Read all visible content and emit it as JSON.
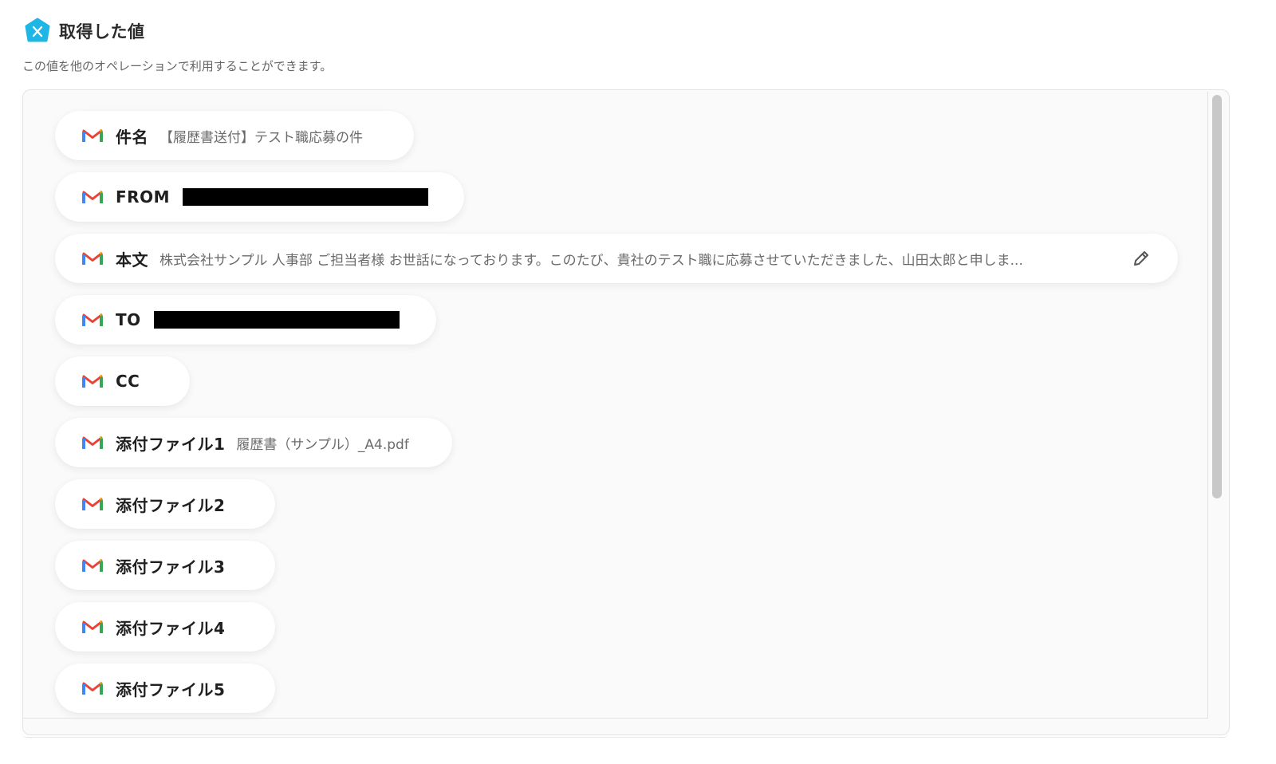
{
  "header": {
    "icon": "x-variable-hexagon-icon",
    "title": "取得した値",
    "subtitle": "この値を他のオペレーションで利用することができます。"
  },
  "colors": {
    "accent": "#1EB6E5",
    "gmail_red": "#EA4335",
    "gmail_blue": "#4285F4",
    "gmail_green": "#34A853",
    "gmail_yellow": "#FBBC04",
    "redaction": "#000000"
  },
  "fields": [
    {
      "icon": "gmail-icon",
      "label": "件名",
      "value": "【履歴書送付】テスト職応募の件"
    },
    {
      "icon": "gmail-icon",
      "label": "FROM",
      "value": "",
      "redacted": true
    },
    {
      "icon": "gmail-icon",
      "label": "本文",
      "value": "株式会社サンプル 人事部 ご担当者様 お世話になっております。このたび、貴社のテスト職に応募させていただきました、山田太郎と申しま...",
      "action_icon": "pencil-edit-icon"
    },
    {
      "icon": "gmail-icon",
      "label": "TO",
      "value": "",
      "redacted": true
    },
    {
      "icon": "gmail-icon",
      "label": "CC",
      "value": ""
    },
    {
      "icon": "gmail-icon",
      "label": "添付ファイル1",
      "value": "履歴書（サンプル）_A4.pdf"
    },
    {
      "icon": "gmail-icon",
      "label": "添付ファイル2",
      "value": ""
    },
    {
      "icon": "gmail-icon",
      "label": "添付ファイル3",
      "value": ""
    },
    {
      "icon": "gmail-icon",
      "label": "添付ファイル4",
      "value": ""
    },
    {
      "icon": "gmail-icon",
      "label": "添付ファイル5",
      "value": ""
    }
  ]
}
